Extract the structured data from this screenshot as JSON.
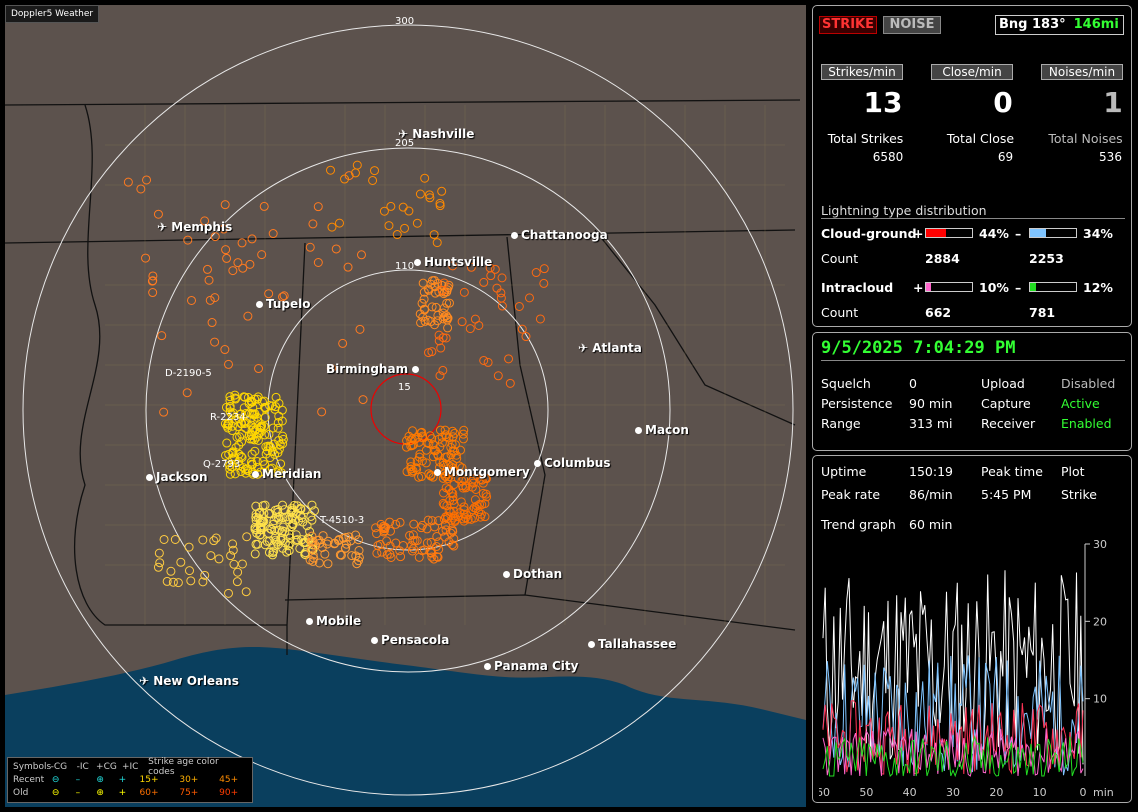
{
  "app": {
    "title": "Doppler5 Weather"
  },
  "map": {
    "cities": [
      {
        "name": "Nashville",
        "airport": true
      },
      {
        "name": "Memphis",
        "airport": true
      },
      {
        "name": "Chattanooga",
        "airport": false
      },
      {
        "name": "Huntsville",
        "airport": false
      },
      {
        "name": "Tupelo",
        "airport": false
      },
      {
        "name": "Atlanta",
        "airport": true
      },
      {
        "name": "Birmingham",
        "airport": false
      },
      {
        "name": "Macon",
        "airport": false
      },
      {
        "name": "Jackson",
        "airport": false
      },
      {
        "name": "Meridian",
        "airport": true
      },
      {
        "name": "Montgomery",
        "airport": false
      },
      {
        "name": "Columbus",
        "airport": false
      },
      {
        "name": "Dothan",
        "airport": false
      },
      {
        "name": "Mobile",
        "airport": false
      },
      {
        "name": "Pensacola",
        "airport": false
      },
      {
        "name": "Tallahassee",
        "airport": false
      },
      {
        "name": "Panama City",
        "airport": false
      },
      {
        "name": "New Orleans",
        "airport": true
      }
    ],
    "range_labels": [
      "300",
      "205",
      "110",
      "15"
    ],
    "pins": [
      "D-2190-5",
      "R-2234-",
      "Q-2793",
      "T-4510-3"
    ]
  },
  "legend": {
    "symbols_label": "Symbols",
    "recent_label": "Recent",
    "old_label": "Old",
    "headers": [
      "-CG",
      "-IC",
      "+CG",
      "+IC"
    ],
    "age_title": "Strike age color codes",
    "recent_ages": [
      "15+",
      "30+",
      "45+"
    ],
    "old_ages": [
      "60+",
      "75+",
      "90+"
    ],
    "age_colors_recent": [
      "#ffd700",
      "#ffb000",
      "#ff8c00"
    ],
    "age_colors_old": [
      "#ff7000",
      "#ff5a00",
      "#ff3c00"
    ]
  },
  "status": {
    "strike_label": "STRIKE",
    "noise_label": "NOISE",
    "bearing": "Bng 183°",
    "distance": "146mi",
    "strikes_min_label": "Strikes/min",
    "close_min_label": "Close/min",
    "noises_min_label": "Noises/min",
    "strikes_min": "13",
    "close_min": "0",
    "noises_min": "1",
    "total_strikes_label": "Total Strikes",
    "total_close_label": "Total Close",
    "total_noises_label": "Total Noises",
    "total_strikes": "6580",
    "total_close": "69",
    "total_noises": "536"
  },
  "distribution": {
    "title": "Lightning type distribution",
    "cg_label": "Cloud-ground",
    "ic_label": "Intracloud",
    "count_label": "Count",
    "cg_pos": {
      "sign": "+",
      "pct": "44%",
      "fill": 0.44,
      "color": "#ff0000",
      "count": "2884"
    },
    "cg_neg": {
      "sign": "–",
      "pct": "34%",
      "fill": 0.34,
      "color": "#7fc4ff",
      "count": "2253"
    },
    "ic_pos": {
      "sign": "+",
      "pct": "10%",
      "fill": 0.1,
      "color": "#ff66cc",
      "count": "662"
    },
    "ic_neg": {
      "sign": "–",
      "pct": "12%",
      "fill": 0.12,
      "color": "#22dd22",
      "count": "781"
    }
  },
  "settings": {
    "datetime": "9/5/2025 7:04:29 PM",
    "squelch_label": "Squelch",
    "squelch": "0",
    "persistence_label": "Persistence",
    "persistence": "90 min",
    "range_label": "Range",
    "range": "313 mi",
    "upload_label": "Upload",
    "upload": "Disabled",
    "capture_label": "Capture",
    "capture": "Active",
    "receiver_label": "Receiver",
    "receiver": "Enabled"
  },
  "stats": {
    "uptime_label": "Uptime",
    "uptime": "150:19",
    "peak_time_label": "Peak time",
    "peak_time": "5:45 PM",
    "plot_label": "Plot",
    "plot": "Strike",
    "peak_rate_label": "Peak rate",
    "peak_rate": "86/min",
    "trend_label": "Trend graph",
    "trend": "60 min"
  },
  "trend_chart": {
    "x_ticks": [
      "60",
      "50",
      "40",
      "30",
      "20",
      "10",
      "0"
    ],
    "x_unit": "min",
    "y_ticks": [
      "30",
      "20",
      "10"
    ],
    "ylim": [
      0,
      30
    ]
  }
}
